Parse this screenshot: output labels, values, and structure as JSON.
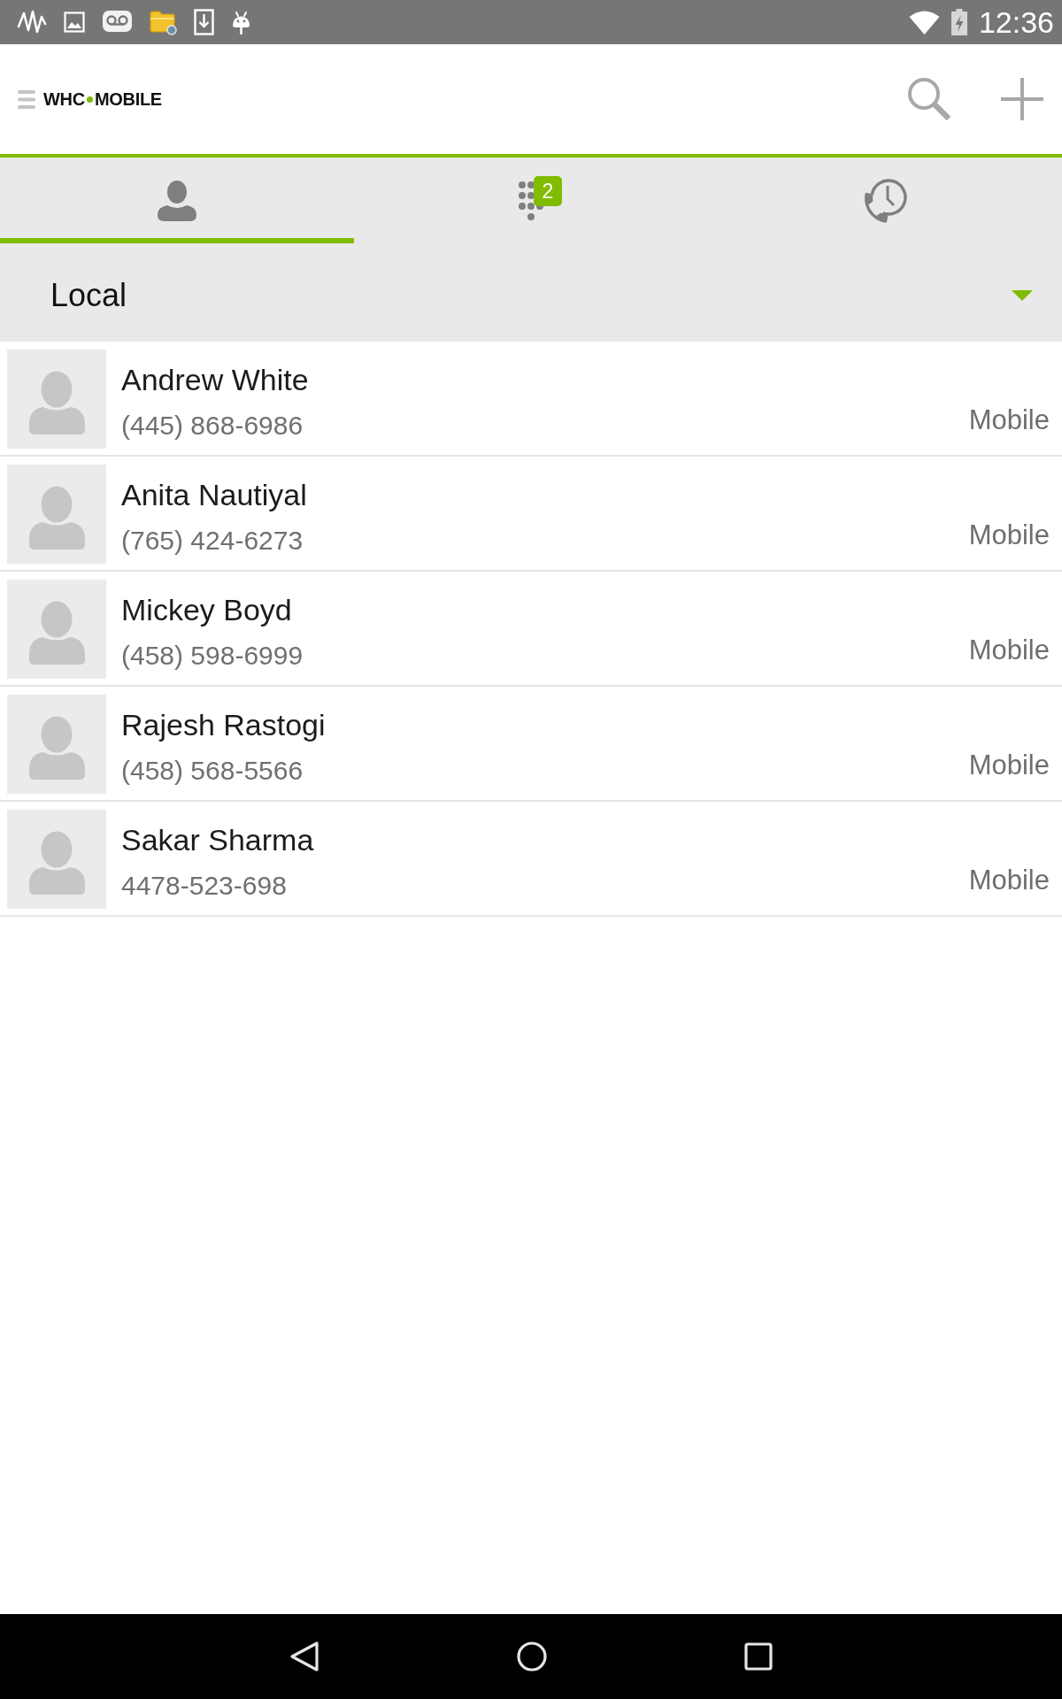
{
  "status_bar": {
    "time": "12:36"
  },
  "header": {
    "logo": {
      "left": "WHC",
      "right": "MOBILE"
    }
  },
  "tabs": [
    {
      "kind": "contacts",
      "selected": true
    },
    {
      "kind": "dialpad",
      "selected": false,
      "badge": "2"
    },
    {
      "kind": "history",
      "selected": false
    }
  ],
  "source_selector": {
    "value": "Local"
  },
  "contacts": [
    {
      "name": "Andrew White",
      "phone": "(445) 868-6986",
      "phone_type": "Mobile"
    },
    {
      "name": "Anita Nautiyal",
      "phone": "(765) 424-6273",
      "phone_type": "Mobile"
    },
    {
      "name": "Mickey Boyd",
      "phone": "(458) 598-6999",
      "phone_type": "Mobile"
    },
    {
      "name": "Rajesh Rastogi",
      "phone": "(458) 568-5566",
      "phone_type": "Mobile"
    },
    {
      "name": "Sakar Sharma",
      "phone": "4478-523-698",
      "phone_type": "Mobile"
    }
  ]
}
